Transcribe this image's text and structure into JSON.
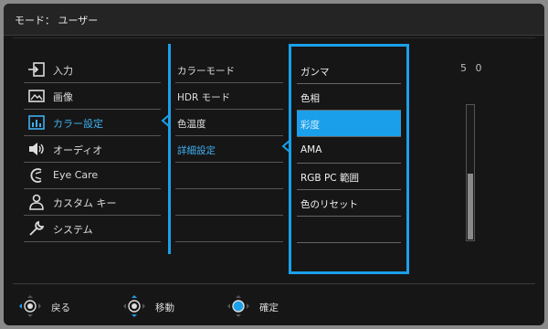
{
  "header": {
    "title": "モード： ユーザー"
  },
  "main_menu": [
    {
      "label": "入力",
      "icon": "input-icon"
    },
    {
      "label": "画像",
      "icon": "picture-icon"
    },
    {
      "label": "カラー設定",
      "icon": "color-settings-icon",
      "active": true
    },
    {
      "label": "オーディオ",
      "icon": "speaker-icon"
    },
    {
      "label": "Eye Care",
      "icon": "eye-care-icon"
    },
    {
      "label": "カスタム キー",
      "icon": "person-icon"
    },
    {
      "label": "システム",
      "icon": "wrench-icon"
    }
  ],
  "sub_menu": [
    {
      "label": "カラーモード"
    },
    {
      "label": "HDR モード"
    },
    {
      "label": "色温度"
    },
    {
      "label": "詳細設定",
      "active": true
    }
  ],
  "detail_menu": [
    {
      "label": "ガンマ"
    },
    {
      "label": "色相"
    },
    {
      "label": "彩度",
      "selected": true
    },
    {
      "label": "AMA"
    },
    {
      "label": "RGB PC 範囲"
    },
    {
      "label": "色のリセット"
    }
  ],
  "value": {
    "text": "5 0",
    "level": 0.5
  },
  "footer": {
    "back_label": "戻る",
    "move_label": "移動",
    "confirm_label": "確定"
  },
  "colors": {
    "accent": "#1aa0ea",
    "background": "#161616",
    "text": "#dddddd"
  }
}
